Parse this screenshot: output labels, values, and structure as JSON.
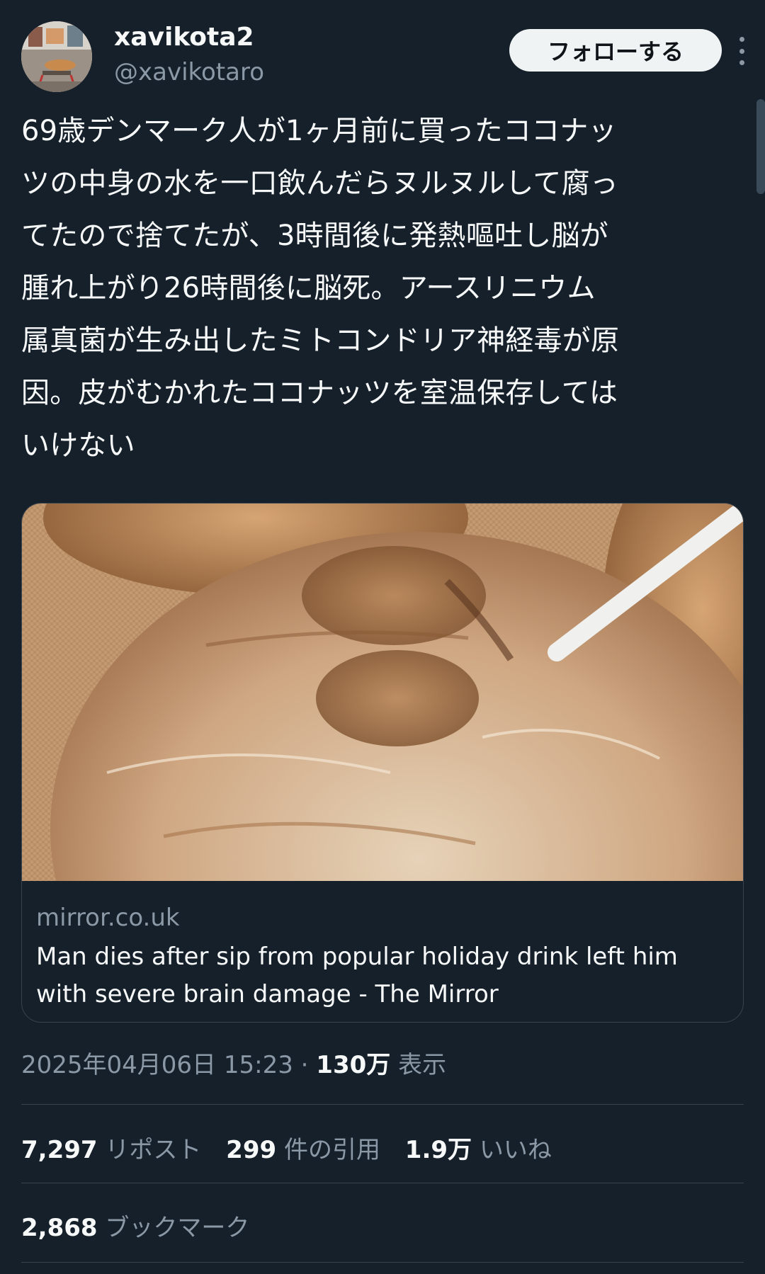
{
  "user": {
    "display_name": "xavikota2",
    "handle": "@xavikotaro"
  },
  "follow_label": "フォローする",
  "tweet": {
    "lines": [
      "69歳デンマーク人が1ヶ月前に買ったココナッ",
      "ツの中身の水を一口飲んだらヌルヌルして腐っ",
      "てたので捨てたが、3時間後に発熱嘔吐し脳が",
      "腫れ上がり26時間後に脳死。アースリニウム",
      "属真菌が生み出したミトコンドリア神経毒が原",
      "因。皮がむかれたココナッツを室温保存しては",
      "いけない"
    ]
  },
  "card": {
    "domain": "mirror.co.uk",
    "title": "Man dies after sip from popular holiday drink left him with severe brain damage - The Mirror"
  },
  "meta": {
    "timestamp": "2025年04月06日 15:23 · ",
    "views_count": "130万",
    "views_label": " 表示"
  },
  "stats": {
    "reposts_count": "7,297",
    "reposts_label": "リポスト",
    "quotes_count": "299",
    "quotes_label": "件の引用",
    "likes_count": "1.9万",
    "likes_label": "いいね",
    "bookmarks_count": "2,868",
    "bookmarks_label": "ブックマーク"
  },
  "colors": {
    "background": "#15202b",
    "text_primary": "#f7f9f9",
    "text_secondary": "#8b98a5",
    "border": "#38444d",
    "follow_bg": "#eff3f4"
  }
}
